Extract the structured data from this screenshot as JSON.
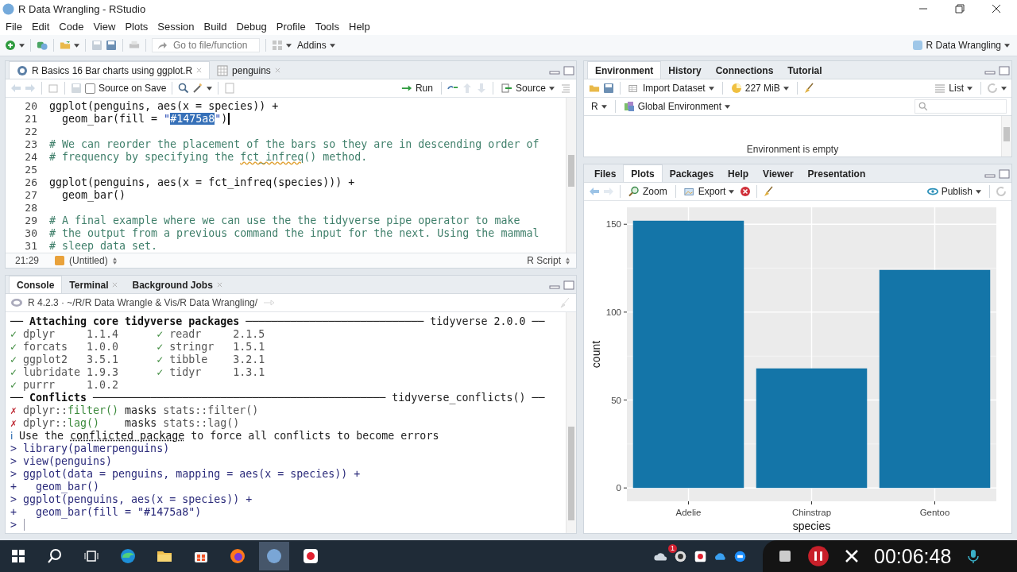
{
  "window": {
    "title": "R Data Wrangling - RStudio"
  },
  "menu": [
    "File",
    "Edit",
    "Code",
    "View",
    "Plots",
    "Session",
    "Build",
    "Debug",
    "Profile",
    "Tools",
    "Help"
  ],
  "toolbar": {
    "search": {
      "placeholder": "Go to file/function"
    },
    "addins": "Addins",
    "project": "R Data Wrangling"
  },
  "editor": {
    "tabs": [
      {
        "label": "R Basics 16 Bar charts using ggplot.R",
        "selected": true,
        "kind": "script"
      },
      {
        "label": "penguins",
        "selected": false,
        "kind": "table"
      }
    ],
    "source_on_save": {
      "label": "Source on Save",
      "checked": false
    },
    "run": "Run",
    "source": "Source",
    "lines": [
      {
        "num": "20",
        "parts": [
          {
            "kind": "code",
            "text": "ggplot(penguins, aes(x = species)) +"
          }
        ]
      },
      {
        "num": "21",
        "cursor": true,
        "parts": [
          {
            "kind": "code",
            "text": "  geom_bar(fill = "
          },
          {
            "kind": "string",
            "text": "\""
          },
          {
            "kind": "selected",
            "text": "#1475a8"
          },
          {
            "kind": "string",
            "text": "\""
          },
          {
            "kind": "code",
            "text": ")"
          }
        ]
      },
      {
        "num": "22"
      },
      {
        "num": "23",
        "parts": [
          {
            "kind": "comment",
            "text": "# We can reorder the placement of the bars so they are in descending order of"
          }
        ]
      },
      {
        "num": "24",
        "parts": [
          {
            "kind": "comment",
            "text": "# frequency by specifying the "
          },
          {
            "kind": "spell",
            "text": "fct_infreq"
          },
          {
            "kind": "comment",
            "text": "() method."
          }
        ]
      },
      {
        "num": "25"
      },
      {
        "num": "26",
        "parts": [
          {
            "kind": "code",
            "text": "ggplot(penguins, aes(x = fct_infreq(species))) +"
          }
        ]
      },
      {
        "num": "27",
        "parts": [
          {
            "kind": "code",
            "text": "  geom_bar()"
          }
        ]
      },
      {
        "num": "28"
      },
      {
        "num": "29",
        "parts": [
          {
            "kind": "comment",
            "text": "# A final example where we can use the the tidyverse pipe operator to make"
          }
        ]
      },
      {
        "num": "30",
        "parts": [
          {
            "kind": "comment",
            "text": "# the output from a previous command the input for the next. Using the mammal"
          }
        ]
      },
      {
        "num": "31",
        "parts": [
          {
            "kind": "comment",
            "text": "# sleep data set."
          }
        ]
      }
    ],
    "status": {
      "position": "21:29",
      "scope": "(Untitled)",
      "filetype": "R Script"
    }
  },
  "console": {
    "tabs": [
      {
        "label": "Console",
        "selected": true,
        "closable": false
      },
      {
        "label": "Terminal",
        "selected": false,
        "closable": true
      },
      {
        "label": "Background Jobs",
        "selected": false,
        "closable": true
      }
    ],
    "path": "R 4.2.3 · ~/R/R Data Wrangle & Vis/R Data Wrangling/",
    "lines": [
      {
        "parts": [
          {
            "kind": "bold",
            "text": "── Attaching core tidyverse packages "
          },
          {
            "kind": "plain",
            "text": "──────────────────────────── tidyverse 2.0.0 ──"
          }
        ]
      },
      {
        "parts": [
          {
            "kind": "check",
            "text": "✓"
          },
          {
            "kind": "pkg",
            "text": " dplyr     1.1.4      "
          },
          {
            "kind": "check",
            "text": "✓"
          },
          {
            "kind": "pkg",
            "text": " readr     2.1.5"
          }
        ]
      },
      {
        "parts": [
          {
            "kind": "check",
            "text": "✓"
          },
          {
            "kind": "pkg",
            "text": " forcats   1.0.0      "
          },
          {
            "kind": "check",
            "text": "✓"
          },
          {
            "kind": "pkg",
            "text": " stringr   1.5.1"
          }
        ]
      },
      {
        "parts": [
          {
            "kind": "check",
            "text": "✓"
          },
          {
            "kind": "pkg",
            "text": " ggplot2   3.5.1      "
          },
          {
            "kind": "check",
            "text": "✓"
          },
          {
            "kind": "pkg",
            "text": " tibble    3.2.1"
          }
        ]
      },
      {
        "parts": [
          {
            "kind": "check",
            "text": "✓"
          },
          {
            "kind": "pkg",
            "text": " lubridate 1.9.3      "
          },
          {
            "kind": "check",
            "text": "✓"
          },
          {
            "kind": "pkg",
            "text": " tidyr     1.3.1"
          }
        ]
      },
      {
        "parts": [
          {
            "kind": "check",
            "text": "✓"
          },
          {
            "kind": "pkg",
            "text": " purrr     1.0.2"
          }
        ]
      },
      {
        "parts": [
          {
            "kind": "bold",
            "text": "── Conflicts "
          },
          {
            "kind": "plain",
            "text": "────────────────────────────────────────────── tidyverse_conflicts() ──"
          }
        ]
      },
      {
        "parts": [
          {
            "kind": "cross",
            "text": "✗"
          },
          {
            "kind": "pkg",
            "text": " dplyr::"
          },
          {
            "kind": "fn",
            "text": "filter()"
          },
          {
            "kind": "plain",
            "text": " masks "
          },
          {
            "kind": "pkg",
            "text": "stats::filter()"
          }
        ]
      },
      {
        "parts": [
          {
            "kind": "cross",
            "text": "✗"
          },
          {
            "kind": "pkg",
            "text": " dplyr::"
          },
          {
            "kind": "fn",
            "text": "lag()"
          },
          {
            "kind": "plain",
            "text": "    masks "
          },
          {
            "kind": "pkg",
            "text": "stats::lag()"
          }
        ]
      },
      {
        "parts": [
          {
            "kind": "info",
            "text": "ℹ"
          },
          {
            "kind": "plain",
            "text": " Use the "
          },
          {
            "kind": "dotted",
            "text": "conflicted package"
          },
          {
            "kind": "plain",
            "text": " to force all conflicts to become errors"
          }
        ]
      },
      {
        "parts": [
          {
            "kind": "prompt",
            "text": "> "
          },
          {
            "kind": "cmd",
            "text": "library(palmerpenguins)"
          }
        ]
      },
      {
        "parts": [
          {
            "kind": "prompt",
            "text": "> "
          },
          {
            "kind": "cmd",
            "text": "view(penguins)"
          }
        ]
      },
      {
        "parts": [
          {
            "kind": "prompt",
            "text": "> "
          },
          {
            "kind": "cmd",
            "text": "ggplot(data = penguins, mapping = aes(x = species)) +"
          }
        ]
      },
      {
        "parts": [
          {
            "kind": "prompt",
            "text": "+ "
          },
          {
            "kind": "cmd",
            "text": "  geom_bar()"
          }
        ]
      },
      {
        "parts": [
          {
            "kind": "prompt",
            "text": "> "
          },
          {
            "kind": "cmd",
            "text": "ggplot(penguins, aes(x = species)) +"
          }
        ]
      },
      {
        "parts": [
          {
            "kind": "prompt",
            "text": "+ "
          },
          {
            "kind": "cmd",
            "text": "  geom_bar(fill = \"#1475a8\")"
          }
        ]
      },
      {
        "cursor": true,
        "parts": [
          {
            "kind": "prompt",
            "text": "> "
          }
        ]
      }
    ]
  },
  "environment": {
    "tabs": [
      {
        "label": "Environment",
        "selected": true
      },
      {
        "label": "History",
        "selected": false
      },
      {
        "label": "Connections",
        "selected": false
      },
      {
        "label": "Tutorial",
        "selected": false
      }
    ],
    "import": "Import Dataset",
    "memory": "227 MiB",
    "view": "List",
    "language": "R",
    "scope": "Global Environment",
    "message": "Environment is empty"
  },
  "plots": {
    "tabs": [
      {
        "label": "Files",
        "selected": false
      },
      {
        "label": "Plots",
        "selected": true
      },
      {
        "label": "Packages",
        "selected": false
      },
      {
        "label": "Help",
        "selected": false
      },
      {
        "label": "Viewer",
        "selected": false
      },
      {
        "label": "Presentation",
        "selected": false
      }
    ],
    "zoom": "Zoom",
    "export": "Export",
    "publish": "Publish",
    "chart_data": {
      "type": "bar",
      "xlabel": "species",
      "ylabel": "count",
      "categories": [
        "Adelie",
        "Chinstrap",
        "Gentoo"
      ],
      "series": [
        {
          "color": "#1475a8",
          "values": [
            152,
            68,
            124
          ]
        }
      ],
      "ylim": [
        -7.6,
        159.6
      ],
      "yticks": [
        0,
        50,
        100,
        150
      ],
      "grid": true
    }
  },
  "taskbar": {
    "badge": "1",
    "timer": "00:06:48"
  }
}
